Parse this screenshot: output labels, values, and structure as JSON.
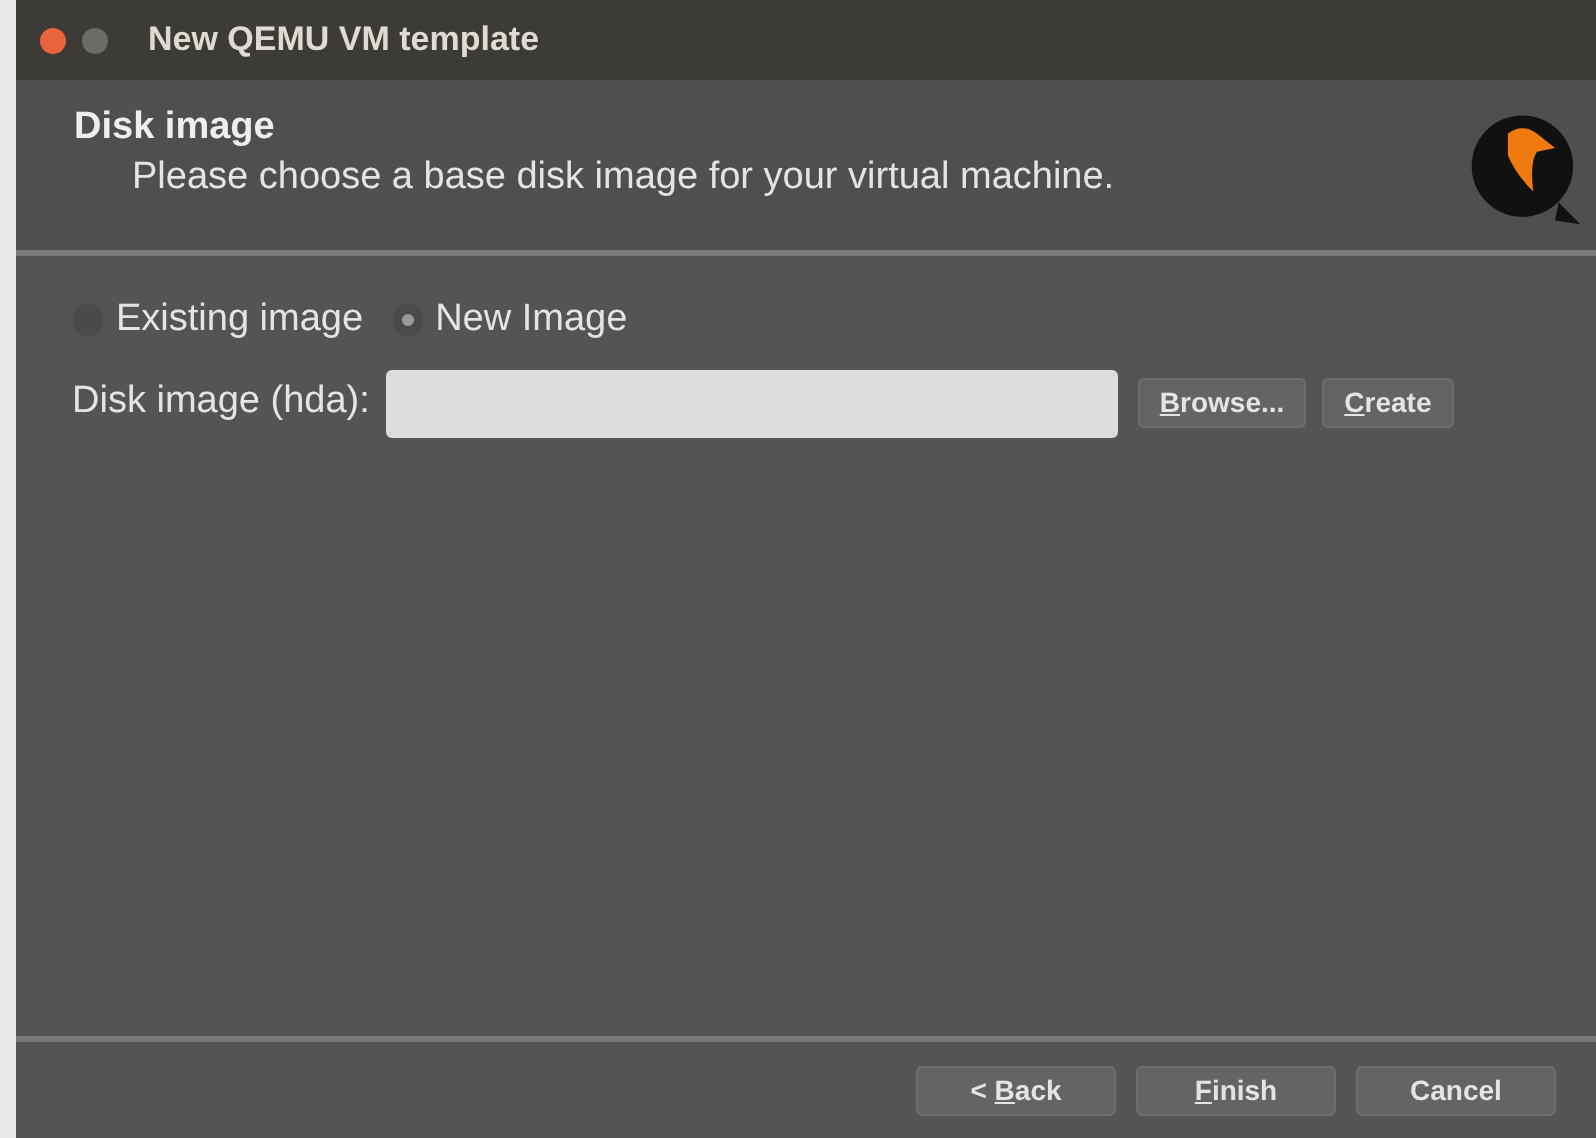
{
  "window": {
    "title": "New QEMU VM template"
  },
  "header": {
    "title": "Disk image",
    "subtitle": "Please choose a base disk image for your virtual machine."
  },
  "image_options": [
    {
      "label": "Existing image",
      "selected": false
    },
    {
      "label": "New Image",
      "selected": true
    }
  ],
  "disk_image": {
    "label": "Disk image (hda):"
  },
  "field_buttons": [
    {
      "mnemonic": "B",
      "rest": "rowse..."
    },
    {
      "mnemonic": "C",
      "rest": "reate"
    }
  ],
  "buttons": [
    {
      "prefix": "< ",
      "mnemonic": "B",
      "rest": "ack"
    },
    {
      "mnemonic": "F",
      "rest": "inish"
    },
    {
      "rest": "Cancel"
    }
  ]
}
